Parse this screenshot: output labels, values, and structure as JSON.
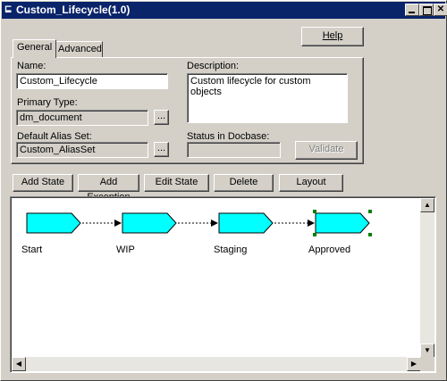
{
  "window": {
    "title": "Custom_Lifecycle(1.0)",
    "help_label": "Help"
  },
  "tabs": [
    {
      "label": "General",
      "selected": true
    },
    {
      "label": "Advanced",
      "selected": false
    }
  ],
  "general": {
    "name_label": "Name:",
    "name_value": "Custom_Lifecycle",
    "description_label": "Description:",
    "description_value": "Custom lifecycle for custom objects",
    "primary_type_label": "Primary Type:",
    "primary_type_value": "dm_document",
    "browse_label": "...",
    "alias_label": "Default Alias Set:",
    "alias_value": "Custom_AliasSet",
    "status_label": "Status in Docbase:",
    "status_value": "",
    "validate_label": "Validate"
  },
  "toolbar": {
    "add_state": "Add State",
    "add_exception": "Add Exception",
    "edit_state": "Edit State",
    "delete": "Delete",
    "layout": "Layout"
  },
  "states": [
    {
      "label": "Start",
      "selected": false
    },
    {
      "label": "WIP",
      "selected": false
    },
    {
      "label": "Staging",
      "selected": false
    },
    {
      "label": "Approved",
      "selected": true
    }
  ],
  "colors": {
    "state_fill": "#00ffff",
    "selection_handle": "#008000",
    "title_bar": "#0a246a"
  }
}
